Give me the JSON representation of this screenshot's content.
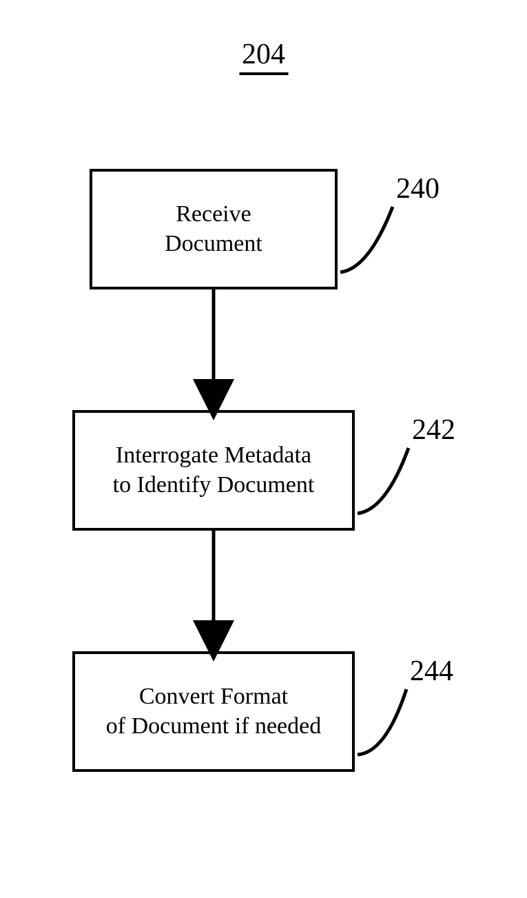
{
  "title": "204",
  "steps": [
    {
      "text": "Receive\nDocument",
      "ref": "240"
    },
    {
      "text": "Interrogate Metadata\nto Identify Document",
      "ref": "242"
    },
    {
      "text": "Convert Format\nof Document if needed",
      "ref": "244"
    }
  ]
}
